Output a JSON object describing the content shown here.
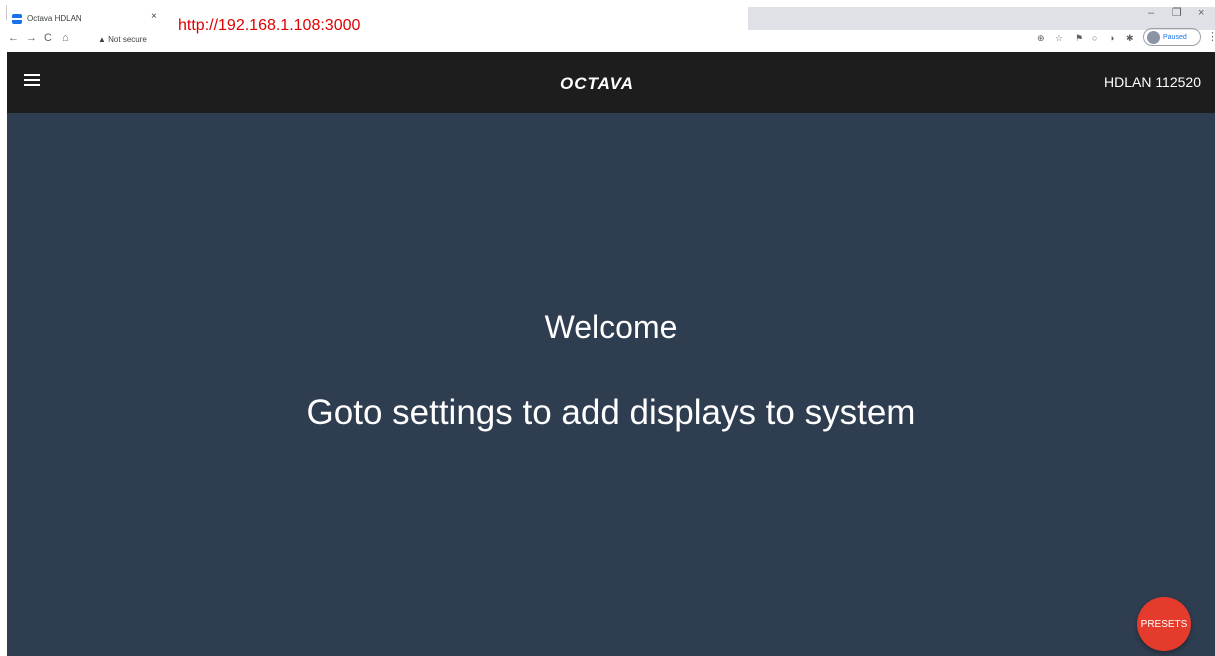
{
  "browser": {
    "tab": {
      "title": "Octava HDLAN",
      "close": "×"
    },
    "window_controls": {
      "minimize": "–",
      "restore": "❐",
      "close": "×"
    },
    "nav": {
      "back": "←",
      "forward": "→",
      "reload": "C",
      "home": "⌂"
    },
    "omnibox": {
      "security_label": "▲ Not secure",
      "url": "http://192.168.1.108:3000"
    },
    "toolbar_icons": [
      "zoom-icon",
      "star-icon",
      "flag-icon",
      "circle-icon",
      "colorwheel-icon",
      "puzzle-icon"
    ],
    "profile": {
      "status": "Paused"
    },
    "menu": "⋮"
  },
  "app": {
    "header": {
      "logo": "OCTAVA",
      "device_name": "HDLAN 112520"
    },
    "main": {
      "welcome": "Welcome",
      "instruction": "Goto settings to add displays to system"
    },
    "presets_button": "PRESETS",
    "colors": {
      "header_bg": "#1d1d1d",
      "main_bg": "#2e3d4f",
      "presets_bg": "#e53b2c",
      "url_highlight": "#e00000"
    }
  }
}
